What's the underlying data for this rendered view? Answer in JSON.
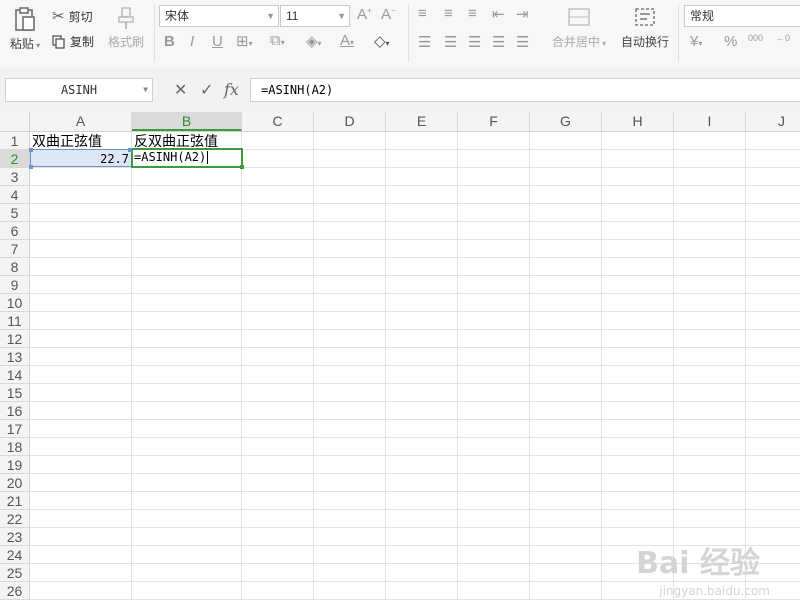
{
  "ribbon": {
    "paste_label": "粘贴",
    "cut_label": "剪切",
    "copy_label": "复制",
    "format_painter_label": "格式刷",
    "font_name": "宋体",
    "font_size": "11",
    "merge_label": "合并居中",
    "wrap_label": "自动换行",
    "number_format": "常规",
    "currency_symbol": "¥",
    "percent_symbol": "%",
    "thousands_symbol": "000",
    "decimal_symbol": "←0"
  },
  "formula_bar": {
    "name_box": "ASINH",
    "cancel_symbol": "✕",
    "confirm_symbol": "✓",
    "fx_label": "fx",
    "formula": "=ASINH(A2)"
  },
  "columns": [
    "A",
    "B",
    "C",
    "D",
    "E",
    "F",
    "G",
    "H",
    "I",
    "J"
  ],
  "rows": [
    "1",
    "2",
    "3",
    "4",
    "5",
    "6",
    "7",
    "8",
    "9",
    "10",
    "11",
    "12",
    "13",
    "14",
    "15",
    "16",
    "17",
    "18",
    "19",
    "20",
    "21",
    "22",
    "23",
    "24",
    "25",
    "26"
  ],
  "cells": {
    "A1": "双曲正弦值",
    "B1": "反双曲正弦值",
    "A2": "22.7",
    "B2": "=ASINH(A2)"
  },
  "watermark": {
    "main": "Bai 经验",
    "sub": "jingyan.baidu.com"
  }
}
